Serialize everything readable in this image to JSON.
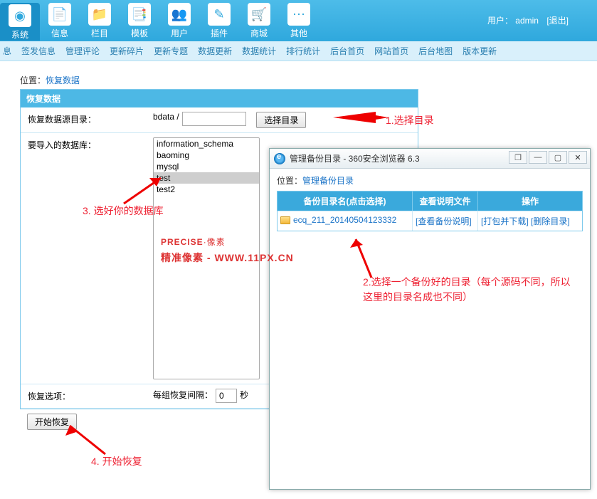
{
  "user": {
    "label": "用户：",
    "name": "admin",
    "logout": "[退出]"
  },
  "nav": [
    {
      "label": "系统",
      "icon": "◉"
    },
    {
      "label": "信息",
      "icon": "📄"
    },
    {
      "label": "栏目",
      "icon": "📁"
    },
    {
      "label": "模板",
      "icon": "📑"
    },
    {
      "label": "用户",
      "icon": "👥"
    },
    {
      "label": "插件",
      "icon": "✎"
    },
    {
      "label": "商城",
      "icon": "🛒"
    },
    {
      "label": "其他",
      "icon": "⋯"
    }
  ],
  "subnav": [
    "息",
    "签发信息",
    "管理评论",
    "更新碎片",
    "更新专题",
    "数据更新",
    "数据统计",
    "排行统计",
    "后台首页",
    "网站首页",
    "后台地图",
    "版本更新"
  ],
  "breadcrumb": {
    "prefix": "位置：",
    "link": "恢复数据"
  },
  "panel": {
    "title": "恢复数据",
    "row1_label": "恢复数据源目录：",
    "row1_prefix": "bdata /",
    "row1_value": "",
    "row1_btn": "选择目录",
    "row2_label": "要导入的数据库：",
    "db_options": [
      "information_schema",
      "baoming",
      "mysql",
      "test",
      "test2"
    ],
    "db_selected": "test",
    "row3_label": "恢复选项：",
    "row3_text": "每组恢复间隔：",
    "row3_value": "0",
    "row3_unit": "秒",
    "submit": "开始恢复"
  },
  "popup": {
    "title": "管理备份目录 - 360安全浏览器 6.3",
    "bc_prefix": "位置：",
    "bc_link": "管理备份目录",
    "head_col1": "备份目录名(点击选择)",
    "head_col2": "查看说明文件",
    "head_col3": "操作",
    "row": {
      "name": "ecq_211_20140504123332",
      "view": "[查看备份说明]",
      "act1": "[打包并下载]",
      "act2": "[删除目录]"
    }
  },
  "annotations": {
    "a1": "1.选择目录",
    "a2": "2.选择一个备份好的目录（每个源码不同，所以这里的目录名成也不同）",
    "a3": "3. 选好你的数据库",
    "a4": "4. 开始恢复"
  },
  "watermark": {
    "l1a": "PRECISE",
    "l1b": "·像素",
    "l2": "精准像素 - WWW.11PX.CN"
  }
}
